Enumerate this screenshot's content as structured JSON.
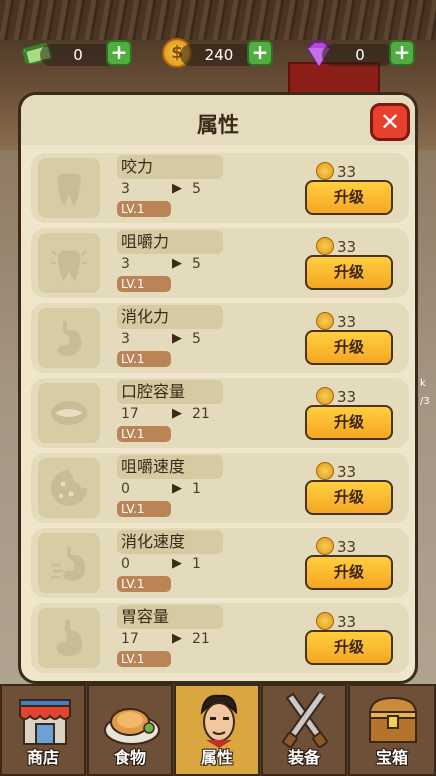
{
  "currency": {
    "cash": "0",
    "coins": "240",
    "gems": "0",
    "coin_symbol": "$",
    "plus_label": "+"
  },
  "background": {
    "side_text": [
      "k",
      "/3"
    ]
  },
  "panel": {
    "title": "属性",
    "close_label": "✕"
  },
  "attributes": [
    {
      "name": "咬力",
      "from": "3",
      "to": "5",
      "level": "LV.1",
      "cost": "33",
      "button": "升级",
      "icon": "tooth-crown-icon"
    },
    {
      "name": "咀嚼力",
      "from": "3",
      "to": "5",
      "level": "LV.1",
      "cost": "33",
      "button": "升级",
      "icon": "tooth-pain-icon"
    },
    {
      "name": "消化力",
      "from": "3",
      "to": "5",
      "level": "LV.1",
      "cost": "33",
      "button": "升级",
      "icon": "stomach-icon"
    },
    {
      "name": "口腔容量",
      "from": "17",
      "to": "21",
      "level": "LV.1",
      "cost": "33",
      "button": "升级",
      "icon": "mouth-icon"
    },
    {
      "name": "咀嚼速度",
      "from": "0",
      "to": "1",
      "level": "LV.1",
      "cost": "33",
      "button": "升级",
      "icon": "cookie-bite-icon"
    },
    {
      "name": "消化速度",
      "from": "0",
      "to": "1",
      "level": "LV.1",
      "cost": "33",
      "button": "升级",
      "icon": "stomach-speed-icon"
    },
    {
      "name": "胃容量",
      "from": "17",
      "to": "21",
      "level": "LV.1",
      "cost": "33",
      "button": "升级",
      "icon": "stomach-capacity-icon"
    }
  ],
  "nav": {
    "tabs": [
      {
        "label": "商店",
        "icon": "shop-icon"
      },
      {
        "label": "食物",
        "icon": "food-plate-icon"
      },
      {
        "label": "属性",
        "icon": "character-face-icon",
        "active": true
      },
      {
        "label": "装备",
        "icon": "fork-knife-icon"
      },
      {
        "label": "宝箱",
        "icon": "treasure-chest-icon"
      }
    ]
  },
  "colors": {
    "panel_bg": "#efe6cc",
    "row_bg": "#e4dbbc",
    "upgrade_button": "#f5a623",
    "close_button": "#e8402f",
    "plus_button": "#4fae3f",
    "active_tab": "#d9a640"
  }
}
